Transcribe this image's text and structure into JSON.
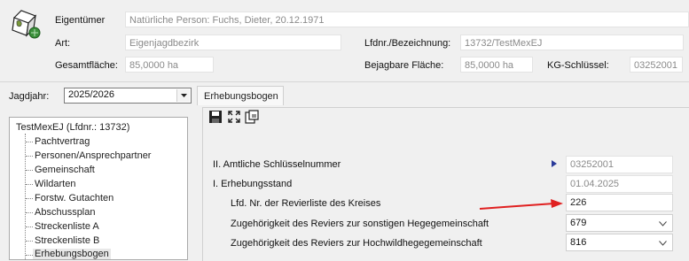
{
  "header": {
    "eigentuemer_label": "Eigentümer",
    "eigentuemer_value": "Natürliche Person: Fuchs, Dieter, 20.12.1971",
    "art_label": "Art:",
    "art_value": "Eigenjagdbezirk",
    "lfdnr_label": "Lfdnr./Bezeichnung:",
    "lfdnr_value": "13732/TestMexEJ",
    "gesamt_label": "Gesamtfläche:",
    "gesamt_value": "85,0000 ha",
    "bejagbar_label": "Bejagbare Fläche:",
    "bejagbar_value": "85,0000 ha",
    "kg_label": "KG-Schlüssel:",
    "kg_value": "03252001",
    "icon": "hunting-district-icon"
  },
  "jagdjahr": {
    "label": "Jagdjahr:",
    "value": "2025/2026"
  },
  "tabs": [
    {
      "label": "Erhebungsbogen",
      "active": true
    }
  ],
  "tree": {
    "root": "TestMexEJ (Lfdnr.: 13732)",
    "items": [
      "Pachtvertrag",
      "Personen/Ansprechpartner",
      "Gemeinschaft",
      "Wildarten",
      "Forstw. Gutachten",
      "Abschussplan",
      "Streckenliste A",
      "Streckenliste B",
      "Erhebungsbogen"
    ],
    "selected": "Erhebungsbogen"
  },
  "toolbar": {
    "save_icon": "save-icon",
    "expand_icon": "expand-icon",
    "export_icon": "export-icon"
  },
  "form": {
    "amtl_label": "II. Amtliche Schlüsselnummer",
    "amtl_value": "03252001",
    "erhebungsstand_label": "I. Erhebungsstand",
    "erhebungsstand_value": "01.04.2025",
    "lfd_label": "Lfd. Nr. der Revierliste des Kreises",
    "lfd_value": "226",
    "hege_label": "Zugehörigkeit des Reviers zur sonstigen Hegegemeinschaft",
    "hege_value": "679",
    "hochwild_label": "Zugehörigkeit des Reviers zur Hochwildhegegemeinschaft",
    "hochwild_value": "816"
  },
  "colors": {
    "annotation_arrow": "#e02020",
    "tree_selected_bg": "#e8e8e8",
    "marker": "#2a3a9a"
  }
}
